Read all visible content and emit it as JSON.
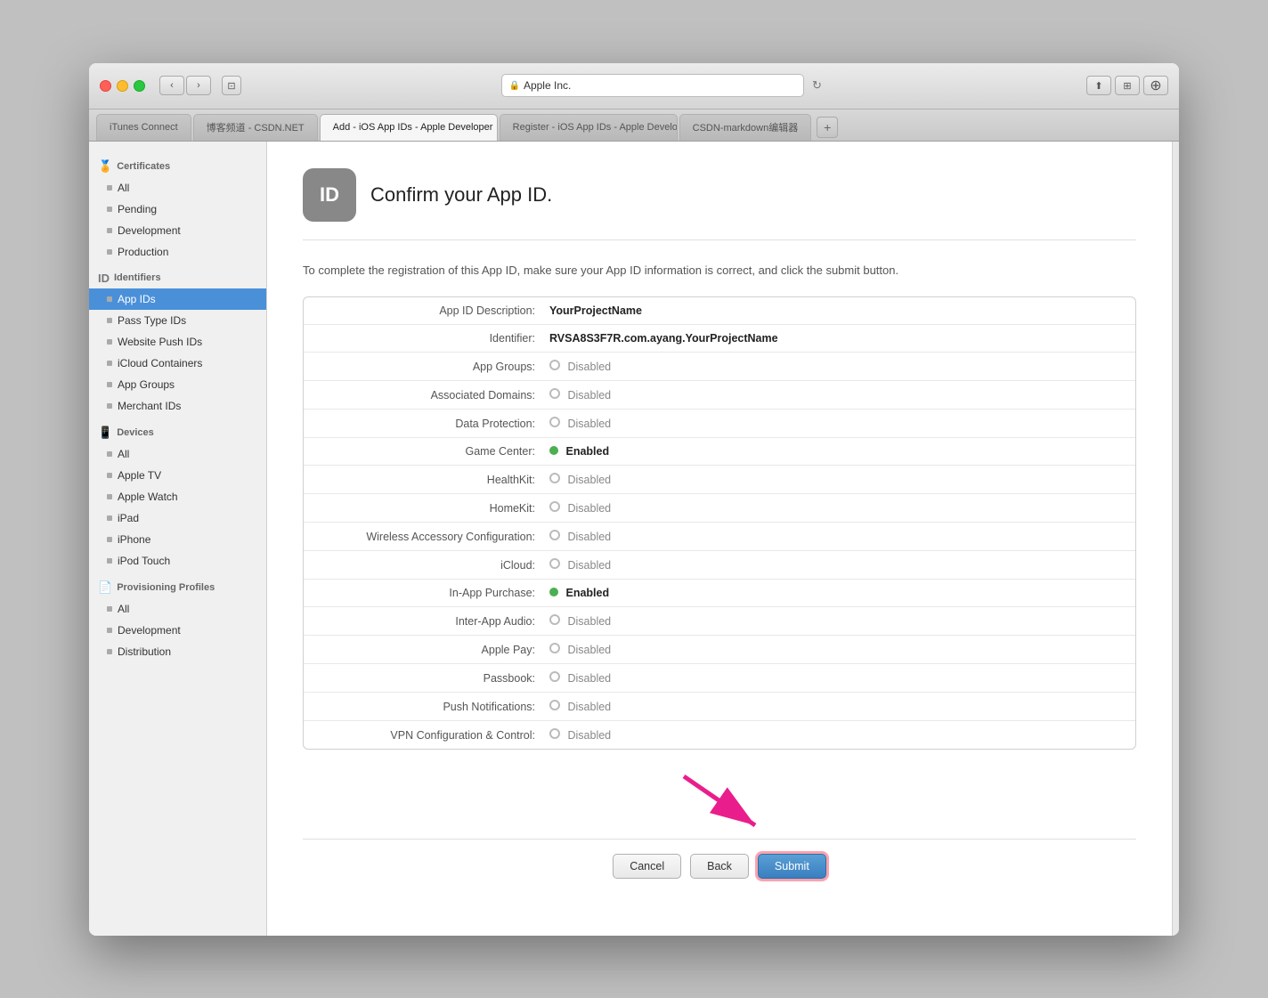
{
  "browser": {
    "address": "Apple Inc.",
    "address_icon": "🔒",
    "tabs": [
      {
        "label": "iTunes Connect",
        "active": false
      },
      {
        "label": "博客频道 - CSDN.NET",
        "active": false
      },
      {
        "label": "Add - iOS App IDs - Apple Developer",
        "active": true
      },
      {
        "label": "Register - iOS App IDs - Apple Developer",
        "active": false
      },
      {
        "label": "CSDN-markdown编辑器",
        "active": false
      }
    ]
  },
  "sidebar": {
    "certificates_section": "Certificates",
    "items_certs": [
      {
        "label": "All"
      },
      {
        "label": "Pending"
      },
      {
        "label": "Development"
      },
      {
        "label": "Production"
      }
    ],
    "identifiers_section": "Identifiers",
    "items_identifiers": [
      {
        "label": "App IDs",
        "active": true
      },
      {
        "label": "Pass Type IDs"
      },
      {
        "label": "Website Push IDs"
      },
      {
        "label": "iCloud Containers"
      },
      {
        "label": "App Groups"
      },
      {
        "label": "Merchant IDs"
      }
    ],
    "devices_section": "Devices",
    "items_devices": [
      {
        "label": "All"
      },
      {
        "label": "Apple TV"
      },
      {
        "label": "Apple Watch"
      },
      {
        "label": "iPad"
      },
      {
        "label": "iPhone"
      },
      {
        "label": "iPod Touch"
      }
    ],
    "provisioning_section": "Provisioning Profiles",
    "items_provisioning": [
      {
        "label": "All"
      },
      {
        "label": "Development"
      },
      {
        "label": "Distribution"
      }
    ]
  },
  "main": {
    "icon_text": "ID",
    "title": "Confirm your App ID.",
    "description": "To complete the registration of this App ID, make sure your App ID information is correct, and click the submit button.",
    "fields": [
      {
        "label": "App ID Description:",
        "value": "YourProjectName",
        "style": "bold"
      },
      {
        "label": "Identifier:",
        "value": "RVSA8S3F7R.com.ayang.YourProjectName",
        "style": "bold"
      },
      {
        "label": "App Groups:",
        "value": "Disabled",
        "style": "disabled"
      },
      {
        "label": "Associated Domains:",
        "value": "Disabled",
        "style": "disabled"
      },
      {
        "label": "Data Protection:",
        "value": "Disabled",
        "style": "disabled"
      },
      {
        "label": "Game Center:",
        "value": "Enabled",
        "style": "enabled"
      },
      {
        "label": "HealthKit:",
        "value": "Disabled",
        "style": "disabled"
      },
      {
        "label": "HomeKit:",
        "value": "Disabled",
        "style": "disabled"
      },
      {
        "label": "Wireless Accessory Configuration:",
        "value": "Disabled",
        "style": "disabled"
      },
      {
        "label": "iCloud:",
        "value": "Disabled",
        "style": "disabled"
      },
      {
        "label": "In-App Purchase:",
        "value": "Enabled",
        "style": "enabled"
      },
      {
        "label": "Inter-App Audio:",
        "value": "Disabled",
        "style": "disabled"
      },
      {
        "label": "Apple Pay:",
        "value": "Disabled",
        "style": "disabled"
      },
      {
        "label": "Passbook:",
        "value": "Disabled",
        "style": "disabled"
      },
      {
        "label": "Push Notifications:",
        "value": "Disabled",
        "style": "disabled"
      },
      {
        "label": "VPN Configuration & Control:",
        "value": "Disabled",
        "style": "disabled"
      }
    ],
    "buttons": {
      "cancel": "Cancel",
      "back": "Back",
      "submit": "Submit"
    }
  }
}
